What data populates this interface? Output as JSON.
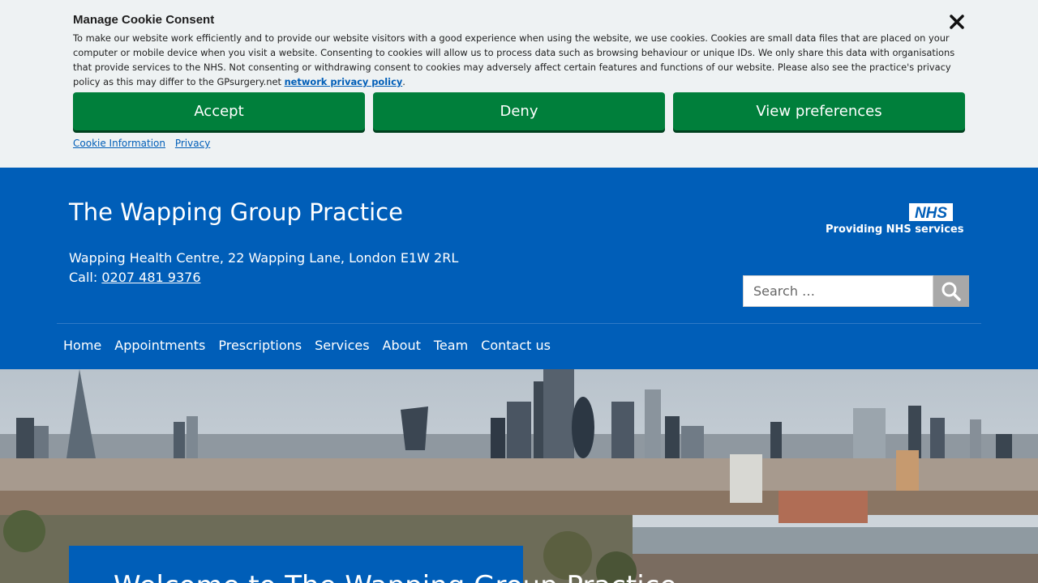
{
  "cookie": {
    "title": "Manage Cookie Consent",
    "text_prefix": "To make our website work efficiently and to provide our website visitors with a good experience when using the website, we use cookies. Cookies are small data files that are placed on your computer or mobile device when you visit a website. Consenting to cookies will allow us to process data such as browsing behaviour or unique IDs. We only share this data with organisations that provide services to the NHS. Not consenting or withdrawing consent to cookies may adversely affect certain features and functions of our website. Please also see the practice's privacy policy as this may differ to the GPsurgery.net ",
    "policy_link": "network privacy policy",
    "text_suffix": ".",
    "accept_label": "Accept",
    "deny_label": "Deny",
    "preferences_label": "View preferences",
    "cookie_info_link": "Cookie Information",
    "privacy_link": "Privacy",
    "button_color": "#007f3b"
  },
  "header": {
    "title": "The Wapping Group Practice",
    "address": "Wapping Health Centre, 22 Wapping Lane, London E1W 2RL",
    "call_label": "Call: ",
    "phone": "0207 481 9376",
    "nhs_logo": "NHS",
    "nhs_tagline": "Providing NHS services",
    "search_placeholder": "Search …",
    "brand_color": "#005eb8"
  },
  "nav": {
    "items": [
      "Home",
      "Appointments",
      "Prescriptions",
      "Services",
      "About",
      "Team",
      "Contact us"
    ]
  },
  "hero": {
    "welcome": "Welcome to The Wapping Group Practice"
  }
}
